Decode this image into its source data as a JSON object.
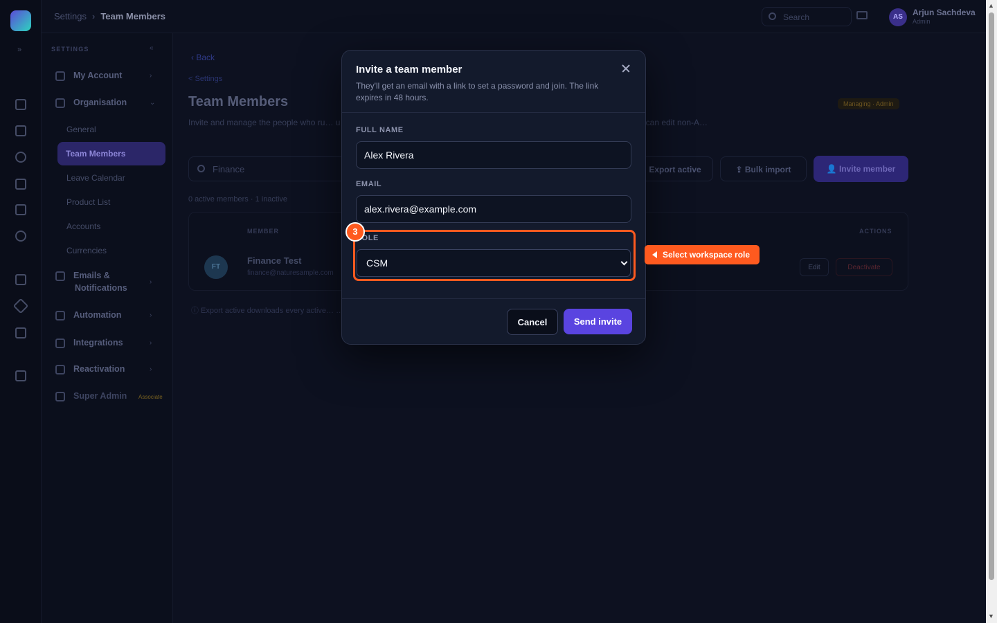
{
  "topbar": {
    "breadcrumb_root": "Settings",
    "breadcrumb_current": "Team Members",
    "search_placeholder": "Search",
    "user_initials": "AS",
    "user_name": "Arjun Sachdeva",
    "user_role": "Admin"
  },
  "sidebar": {
    "section_label": "SETTINGS",
    "items": [
      {
        "label": "My Account"
      },
      {
        "label": "Organisation"
      },
      {
        "label": "Emails &"
      },
      {
        "label": "Notifications"
      },
      {
        "label": "Automation"
      },
      {
        "label": "Integrations"
      },
      {
        "label": "Reactivation"
      },
      {
        "label": "Super Admin"
      }
    ],
    "sub_items": [
      "General",
      "Team Members",
      "Leave Calendar",
      "Product List",
      "Accounts",
      "Currencies"
    ],
    "super_admin_badge": "Associate"
  },
  "main": {
    "back_label": "Back",
    "back_sub": "< Settings",
    "title": "Team Members",
    "managing_badge": "Managing · Admin",
    "description": "Invite and manage the people who ru… u invite, they accept, they're in. Admins invite, edit, deactivate and bulk import. CSM can edit non-A…",
    "search_value": "Finance",
    "export_label": "Export active",
    "bulk_import_label": "Bulk import",
    "invite_label": "Invite member",
    "count_line": "0 active members · 1 inactive",
    "table": {
      "col_member": "MEMBER",
      "col_actions": "ACTIONS",
      "row": {
        "initials": "FT",
        "name": "Finance Test",
        "email": "finance@naturesample.com",
        "edit": "Edit",
        "deactivate": "Deactivate"
      }
    },
    "foot_note": "ⓘ Export active downloads every active… … nactive member revokes their sign-in immediately — no re-accept needed."
  },
  "modal": {
    "title": "Invite a team member",
    "subtitle": "They'll get an email with a link to set a password and join. The link expires in 48 hours.",
    "full_name_label": "FULL NAME",
    "full_name_value": "Alex Rivera",
    "email_label": "EMAIL",
    "email_value": "alex.rivera@example.com",
    "role_label": "ROLE",
    "role_value": "CSM",
    "role_options": [
      "CSM"
    ],
    "cancel_label": "Cancel",
    "send_label": "Send invite"
  },
  "tour": {
    "step_number": "3",
    "callout_text": "Select workspace role",
    "accent": "#ff5a1f"
  },
  "colors": {
    "primary": "#5a44e0",
    "modal_bg": "#131a2c",
    "page_bg": "#0d1120"
  }
}
